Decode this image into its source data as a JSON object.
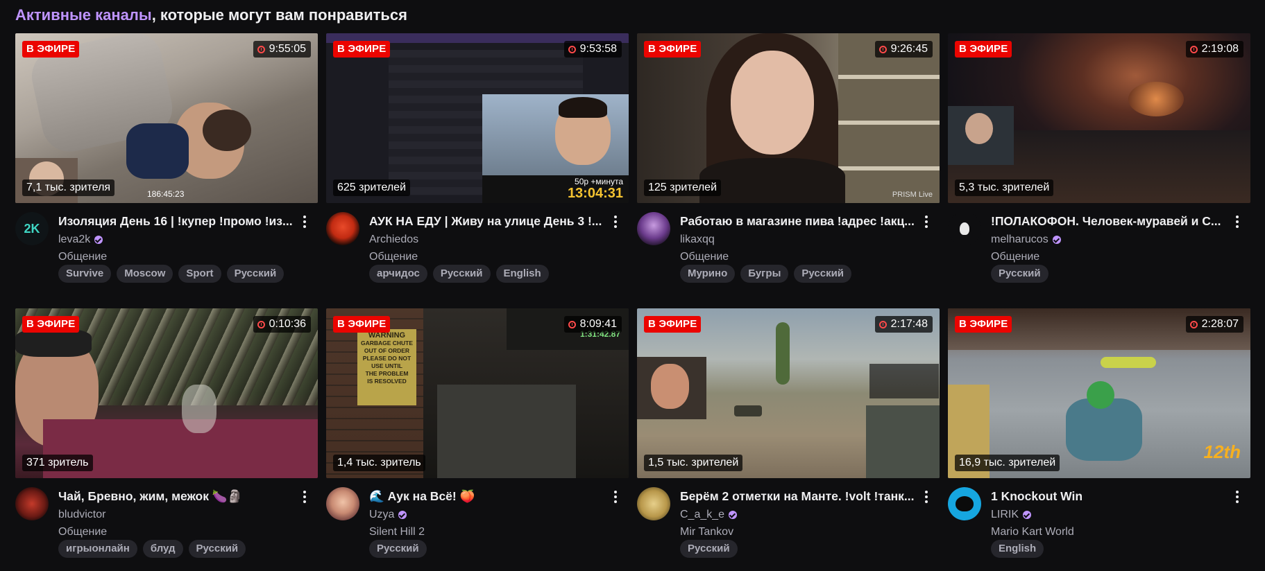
{
  "section": {
    "title_accent": "Активные каналы",
    "title_rest": ", которые могут вам понравиться"
  },
  "live_label": "В ЭФИРЕ",
  "streams": [
    {
      "uptime": "9:55:05",
      "viewers": "7,1 тыс. зрителя",
      "overlay_text": "186:45:23",
      "title": "Изоляция День 16 | !купер !промо !из...",
      "channel": "leva2k",
      "verified": true,
      "avatar_text": "2K",
      "category": "Общение",
      "tags": [
        "Survive",
        "Moscow",
        "Sport",
        "Русский"
      ]
    },
    {
      "uptime": "9:53:58",
      "viewers": "625 зрителей",
      "overlay_text": "13:04:31",
      "overlay_text_2": "50р +минута",
      "title": "АУК НА ЕДУ | Живу на улице День 3 !...",
      "channel": "Archiedos",
      "verified": false,
      "avatar_text": "",
      "category": "Общение",
      "tags": [
        "арчидос",
        "Русский",
        "English"
      ]
    },
    {
      "uptime": "9:26:45",
      "viewers": "125 зрителей",
      "overlay_text": "PRISM Live",
      "title": "Работаю в магазине пива !адрес !акц...",
      "channel": "likaxqq",
      "verified": false,
      "avatar_text": "",
      "category": "Общение",
      "tags": [
        "Мурино",
        "Бугры",
        "Русский"
      ]
    },
    {
      "uptime": "2:19:08",
      "viewers": "5,3 тыс. зрителей",
      "overlay_text": "",
      "title": "!ПОЛАКОФОН. Человек-муравей и С...",
      "channel": "melharucos",
      "verified": true,
      "avatar_text": "",
      "category": "Общение",
      "tags": [
        "Русский"
      ]
    },
    {
      "uptime": "0:10:36",
      "viewers": "371 зритель",
      "overlay_text": "",
      "title": "Чай, Бревно, жим, межок 🍆🗿",
      "channel": "bludvictor",
      "verified": false,
      "avatar_text": "",
      "category": "Общение",
      "tags": [
        "игрыонлайн",
        "блуд",
        "Русский"
      ]
    },
    {
      "uptime": "8:09:41",
      "viewers": "1,4 тыс. зритель",
      "overlay_text": "1:31:42.87",
      "sign_lines": [
        "WARNING",
        "GARBAGE CHUTE",
        "OUT OF ORDER",
        "PLEASE DO NOT",
        "USE UNTIL",
        "THE PROBLEM",
        "IS RESOLVED"
      ],
      "title": "🌊 Аук на Всё! 🍑",
      "channel": "Uzya",
      "verified": true,
      "avatar_text": "",
      "category": "Silent Hill 2",
      "tags": [
        "Русский"
      ]
    },
    {
      "uptime": "2:17:48",
      "viewers": "1,5 тыс. зрителей",
      "overlay_text": "",
      "title": "Берём 2 отметки на Манте. !volt !танк...",
      "channel": "C_a_k_e",
      "verified": true,
      "avatar_text": "",
      "category": "Mir Tankov",
      "tags": [
        "Русский"
      ]
    },
    {
      "uptime": "2:28:07",
      "viewers": "16,9 тыс. зрителей",
      "overlay_text": "12th",
      "title": "1 Knockout Win",
      "channel": "LIRIK",
      "verified": true,
      "avatar_text": "",
      "category": "Mario Kart World",
      "tags": [
        "English"
      ]
    }
  ],
  "colors": {
    "background": "#0e0e10",
    "accent": "#bf94ff",
    "live_badge": "#eb0400",
    "tag_bg": "#26262c",
    "muted_text": "#adadb8"
  }
}
